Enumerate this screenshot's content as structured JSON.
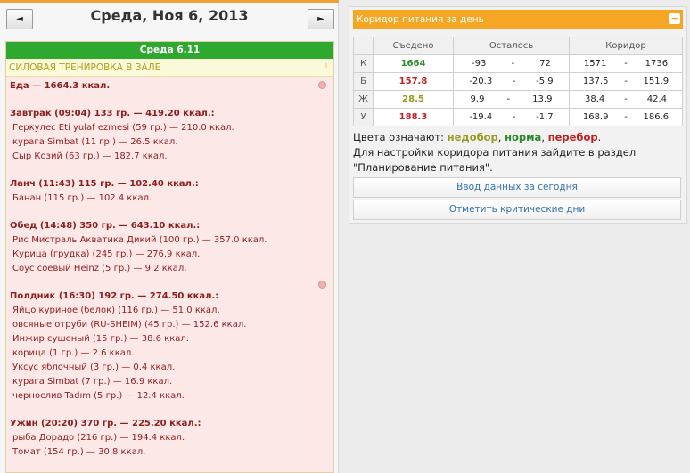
{
  "nav": {
    "prev_label": "◄",
    "next_label": "►",
    "date_title": "Среда, Ноя 6, 2013"
  },
  "diary": {
    "day_header": "Среда 6.11",
    "training": "СИЛОВАЯ ТРЕНИРОВКА В ЗАЛЕ",
    "training_mark": "!",
    "total": "Еда — 1664.3 ккал.",
    "meals": [
      {
        "head": "Завтрак (09:04) 133 гр. — 419.20 ккал.:",
        "items": [
          "Геркулес Eti yulaf ezmesi (59 гр.) — 210.0 ккал.",
          "курага Simbat (11 гр.) — 26.5 ккал.",
          "Сыр Козий (63 гр.) — 182.7 ккал."
        ]
      },
      {
        "head": "Ланч (11:43) 115 гр. — 102.40 ккал.:",
        "items": [
          "Банан (115 гр.) — 102.4 ккал."
        ]
      },
      {
        "head": "Обед (14:48) 350 гр. — 643.10 ккал.:",
        "items": [
          "Рис Мистраль Акватика Дикий (100 гр.) — 357.0 ккал.",
          "Курица (грудка) (245 гр.) — 276.9 ккал.",
          "Соус соевый Heinz (5 гр.) — 9.2 ккал."
        ]
      },
      {
        "head": "Полдник (16:30) 192 гр. — 274.50 ккал.:",
        "items": [
          "Яйцо куриное (белок) (116 гр.) — 51.0 ккал.",
          "овсяные отруби (RU-SHEIM) (45 гр.) — 152.6 ккал.",
          "Инжир сушеный (15 гр.) — 38.6 ккал.",
          "корица (1 гр.) — 2.6 ккал.",
          "Уксус яблочный (3 гр.) — 0.4 ккал.",
          "курага Simbat (7 гр.) — 16.9 ккал.",
          "чернослив Tadım (5 гр.) — 12.4 ккал."
        ]
      },
      {
        "head": "Ужин (20:20) 370 гр. — 225.20 ккал.:",
        "items": [
          "рыба Дорадо (216 гр.) — 194.4 ккал.",
          "Томат (154 гр.) — 30.8 ккал."
        ]
      }
    ]
  },
  "corridor": {
    "title": "Коридор питания за день",
    "collapse_label": "−",
    "headers": [
      "",
      "Съедено",
      "Осталось",
      "Коридор"
    ],
    "rows": [
      {
        "label": "К",
        "eaten": "1664",
        "eaten_color": "#2a8a2a",
        "left_min": "-93",
        "left_max": "72",
        "corr_min": "1571",
        "corr_max": "1736"
      },
      {
        "label": "Б",
        "eaten": "157.8",
        "eaten_color": "#c02020",
        "left_min": "-20.3",
        "left_max": "-5.9",
        "corr_min": "137.5",
        "corr_max": "151.9"
      },
      {
        "label": "Ж",
        "eaten": "28.5",
        "eaten_color": "#9a9a20",
        "left_min": "9.9",
        "left_max": "13.9",
        "corr_min": "38.4",
        "corr_max": "42.4"
      },
      {
        "label": "У",
        "eaten": "188.3",
        "eaten_color": "#c02020",
        "left_min": "-19.4",
        "left_max": "-1.7",
        "corr_min": "168.9",
        "corr_max": "186.6"
      }
    ],
    "range_sep": "-",
    "legend_prefix": "Цвета означают: ",
    "legend_under": "недобор",
    "legend_norm": "норма",
    "legend_over": "перебор",
    "legend_comma": ", ",
    "legend_dot": ".",
    "hint": "Для настройки коридора питания зайдите в раздел \"Планирование питания\".",
    "btn_enter": "Ввод данных за сегодня",
    "btn_critical": "Отметить критические дни"
  },
  "colors": {
    "accent_orange": "#f5a623",
    "day_header_green": "#2fa82f",
    "meal_text": "#8b1e1e",
    "under": "#9a9a20",
    "norm": "#2a8a2a",
    "over": "#c02020"
  }
}
